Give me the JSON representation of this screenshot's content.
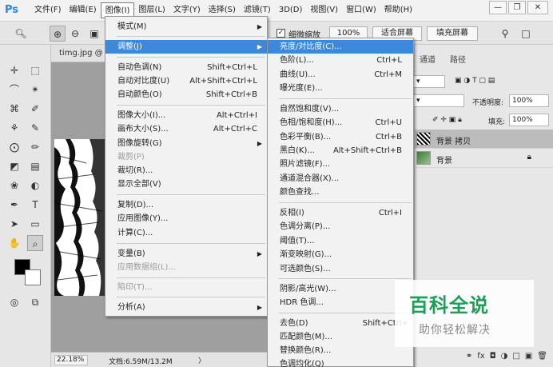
{
  "app": {
    "logo": "Ps"
  },
  "menubar": {
    "items": [
      "文件(F)",
      "编辑(E)",
      "图像(I)",
      "图层(L)",
      "文字(Y)",
      "选择(S)",
      "滤镜(T)",
      "3D(D)",
      "视图(V)",
      "窗口(W)",
      "帮助(H)"
    ],
    "active": "图像(I)"
  },
  "window_controls": {
    "minimize": "—",
    "restore": "❐",
    "close": "✕"
  },
  "options_bar": {
    "scrubby_zoom_label": "细微缩放",
    "scrubby_zoom_checked": true,
    "zoom_100": "100%",
    "fit_screen": "适合屏幕",
    "fill_screen": "填充屏幕"
  },
  "document": {
    "tab_label": "timg.jpg @ 2",
    "zoom": "22.18%",
    "doc_info": "文档:6.59M/13.2M",
    "status_arrow": "〉"
  },
  "right_panel": {
    "tabs": [
      "通道",
      "路径"
    ],
    "opacity_label": "不透明度:",
    "opacity_value": "100%",
    "fill_label": "填充:",
    "fill_value": "100%",
    "layers": [
      {
        "name": "背景 拷贝",
        "selected": true
      },
      {
        "name": "背景",
        "selected": false,
        "locked": true
      }
    ]
  },
  "image_menu": {
    "items": [
      {
        "label": "模式(M)",
        "submenu": true
      },
      {
        "label": "调整(J)",
        "submenu": true,
        "highlight": true
      },
      {
        "label": "自动色调(N)",
        "shortcut": "Shift+Ctrl+L"
      },
      {
        "label": "自动对比度(U)",
        "shortcut": "Alt+Shift+Ctrl+L"
      },
      {
        "label": "自动颜色(O)",
        "shortcut": "Shift+Ctrl+B"
      },
      {
        "label": "图像大小(I)...",
        "shortcut": "Alt+Ctrl+I"
      },
      {
        "label": "画布大小(S)...",
        "shortcut": "Alt+Ctrl+C"
      },
      {
        "label": "图像旋转(G)",
        "submenu": true
      },
      {
        "label": "裁剪(P)",
        "disabled": true
      },
      {
        "label": "裁切(R)..."
      },
      {
        "label": "显示全部(V)"
      },
      {
        "label": "复制(D)..."
      },
      {
        "label": "应用图像(Y)..."
      },
      {
        "label": "计算(C)..."
      },
      {
        "label": "变量(B)",
        "submenu": true
      },
      {
        "label": "应用数据组(L)...",
        "disabled": true
      },
      {
        "label": "陷印(T)...",
        "disabled": true
      },
      {
        "label": "分析(A)",
        "submenu": true
      }
    ]
  },
  "adjust_menu": {
    "items": [
      {
        "label": "亮度/对比度(C)...",
        "highlight": true
      },
      {
        "label": "色阶(L)...",
        "shortcut": "Ctrl+L"
      },
      {
        "label": "曲线(U)...",
        "shortcut": "Ctrl+M"
      },
      {
        "label": "曝光度(E)..."
      },
      {
        "label": "自然饱和度(V)..."
      },
      {
        "label": "色相/饱和度(H)...",
        "shortcut": "Ctrl+U"
      },
      {
        "label": "色彩平衡(B)...",
        "shortcut": "Ctrl+B"
      },
      {
        "label": "黑白(K)...",
        "shortcut": "Alt+Shift+Ctrl+B"
      },
      {
        "label": "照片滤镜(F)..."
      },
      {
        "label": "通道混合器(X)..."
      },
      {
        "label": "颜色查找..."
      },
      {
        "label": "反相(I)",
        "shortcut": "Ctrl+I"
      },
      {
        "label": "色调分离(P)..."
      },
      {
        "label": "阈值(T)..."
      },
      {
        "label": "渐变映射(G)..."
      },
      {
        "label": "可选颜色(S)..."
      },
      {
        "label": "阴影/高光(W)..."
      },
      {
        "label": "HDR 色调..."
      },
      {
        "label": "去色(D)",
        "shortcut": "Shift+Ctrl+"
      },
      {
        "label": "匹配颜色(M)..."
      },
      {
        "label": "替换颜色(R)..."
      },
      {
        "label": "色调均化(Q)"
      }
    ]
  },
  "watermark": {
    "title": "百科全说",
    "subtitle": "助你轻松解决"
  },
  "colors": {
    "accent": "#3c89da",
    "watermark_green": "#1c9e58"
  }
}
